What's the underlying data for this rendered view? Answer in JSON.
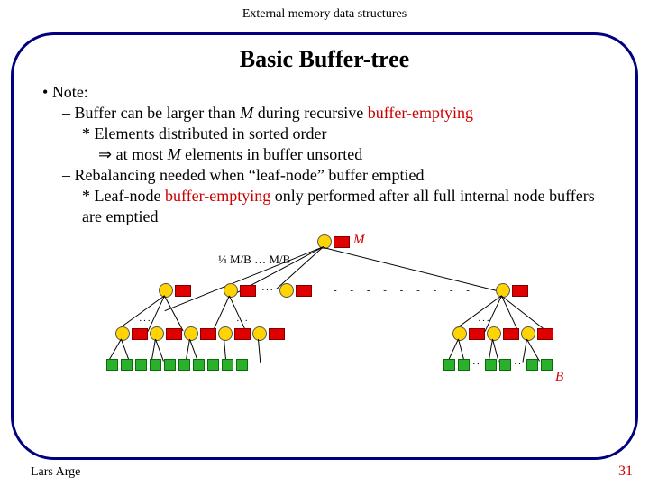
{
  "header": "External memory data structures",
  "title": "Basic Buffer-tree",
  "bullets": {
    "note": "Note:",
    "l1a": "Buffer can be larger than ",
    "l1_M": "M",
    "l1b": " during recursive ",
    "l1_red": "buffer-emptying",
    "l2": "Elements distributed in sorted order",
    "l3a": " at most ",
    "l3_M": "M",
    "l3b": " elements in buffer unsorted",
    "l4": "Rebalancing needed when “leaf-node” buffer emptied",
    "l5a": "Leaf-node ",
    "l5_red": "buffer-emptying",
    "l5b": " only performed after all full internal node buffers are emptied"
  },
  "diagram": {
    "label_M": "M",
    "label_B": "B",
    "math_frac": "¼ M/B … M/B"
  },
  "footer": {
    "author": "Lars Arge",
    "page": "31"
  }
}
